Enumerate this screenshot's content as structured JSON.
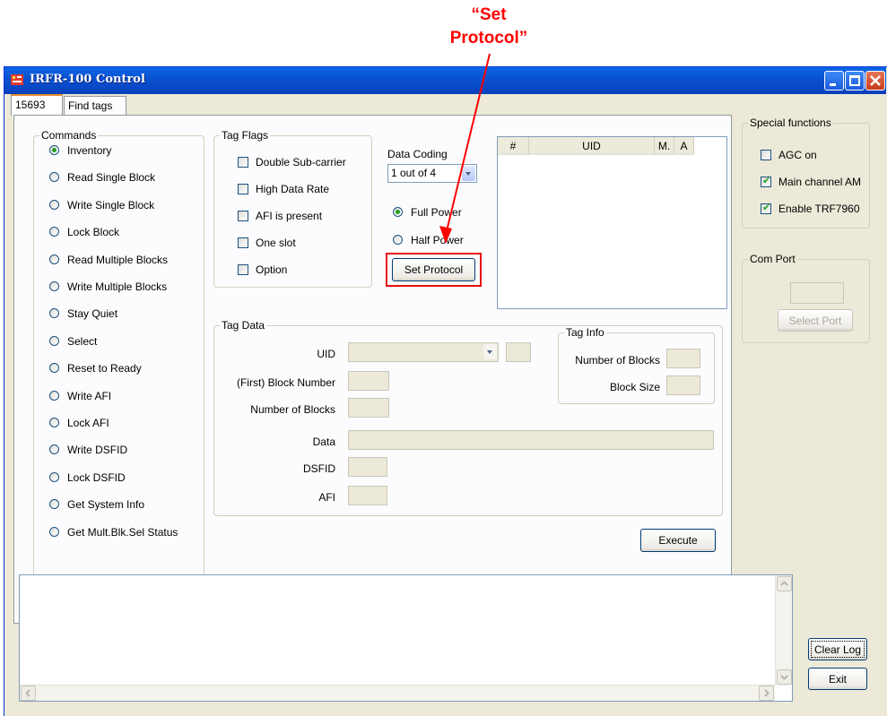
{
  "annotation": {
    "line1": "“Set",
    "line2": "Protocol”",
    "color": "#ff0000"
  },
  "window": {
    "title": "IRFR-100 Control"
  },
  "tabs": [
    {
      "label": "15693",
      "active": true
    },
    {
      "label": "Find tags",
      "active": false
    }
  ],
  "commands": {
    "legend": "Commands",
    "items": [
      {
        "label": "Inventory",
        "selected": true
      },
      {
        "label": "Read Single Block",
        "selected": false
      },
      {
        "label": "Write Single Block",
        "selected": false
      },
      {
        "label": "Lock Block",
        "selected": false
      },
      {
        "label": "Read Multiple Blocks",
        "selected": false
      },
      {
        "label": "Write Multiple Blocks",
        "selected": false
      },
      {
        "label": "Stay Quiet",
        "selected": false
      },
      {
        "label": "Select",
        "selected": false
      },
      {
        "label": "Reset to Ready",
        "selected": false
      },
      {
        "label": "Write AFI",
        "selected": false
      },
      {
        "label": "Lock AFI",
        "selected": false
      },
      {
        "label": "Write DSFID",
        "selected": false
      },
      {
        "label": "Lock DSFID",
        "selected": false
      },
      {
        "label": "Get System Info",
        "selected": false
      },
      {
        "label": "Get Mult.Blk.Sel Status",
        "selected": false
      }
    ]
  },
  "tag_flags": {
    "legend": "Tag Flags",
    "items": [
      {
        "label": "Double Sub-carrier",
        "checked": false
      },
      {
        "label": "High Data Rate",
        "checked": false
      },
      {
        "label": "AFI is present",
        "checked": false
      },
      {
        "label": "One slot",
        "checked": false
      },
      {
        "label": "Option",
        "checked": false
      }
    ]
  },
  "data_coding": {
    "label": "Data Coding",
    "value": "1 out of 4"
  },
  "power": [
    {
      "label": "Full Power",
      "selected": true
    },
    {
      "label": "Half Power",
      "selected": false
    }
  ],
  "set_protocol_label": "Set Protocol",
  "uid_list": {
    "columns": [
      "#",
      "UID",
      "M.",
      "A"
    ]
  },
  "tag_data": {
    "legend": "Tag Data",
    "uid_label": "UID",
    "first_block_label": "(First) Block Number",
    "num_blocks_label": "Number of Blocks",
    "data_label": "Data",
    "dsfid_label": "DSFID",
    "afi_label": "AFI"
  },
  "tag_info": {
    "legend": "Tag Info",
    "num_blocks_label": "Number of Blocks",
    "block_size_label": "Block Size"
  },
  "execute_label": "Execute",
  "special_functions": {
    "legend": "Special functions",
    "items": [
      {
        "label": "AGC on",
        "checked": false
      },
      {
        "label": "Main channel AM",
        "checked": true
      },
      {
        "label": "Enable TRF7960",
        "checked": true
      }
    ]
  },
  "com_port": {
    "legend": "Com Port",
    "button_label": "Select Port"
  },
  "log": {
    "clear_label": "Clear Log",
    "exit_label": "Exit"
  }
}
